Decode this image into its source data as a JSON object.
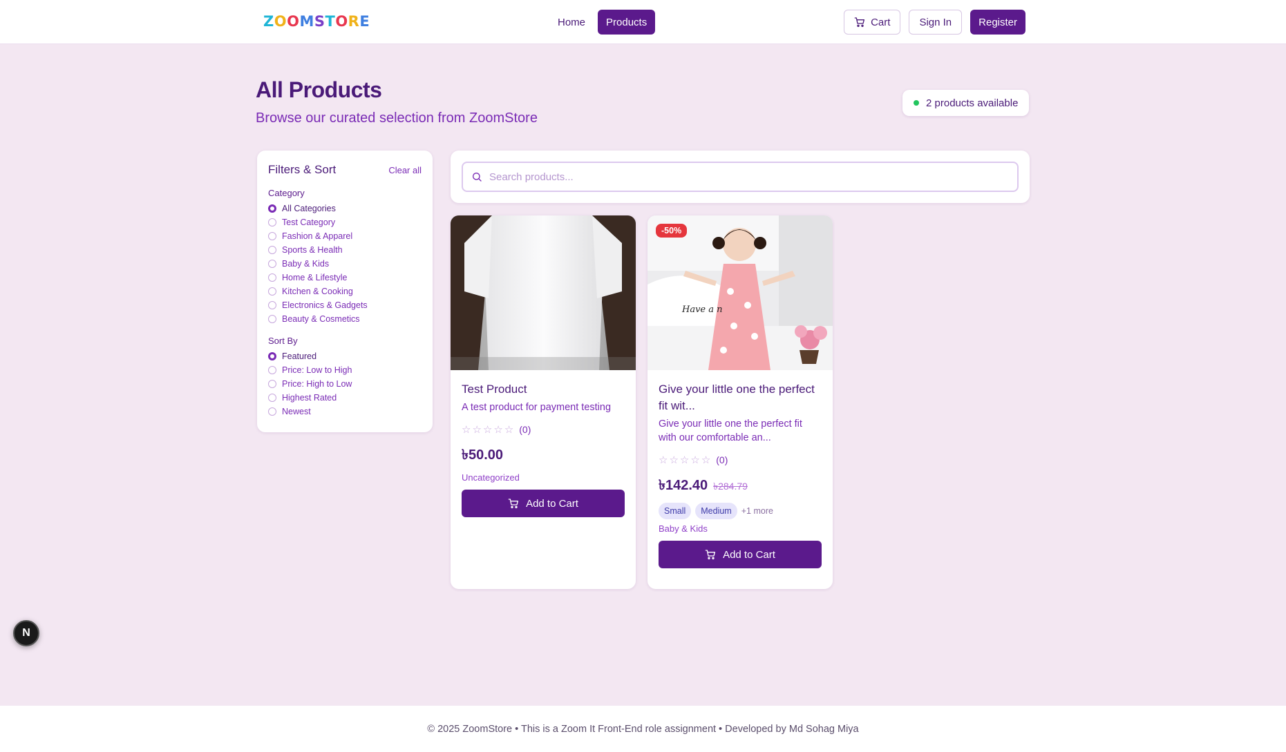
{
  "header": {
    "logo_letters": [
      "Z",
      "O",
      "O",
      "M",
      "S",
      "T",
      "O",
      "R",
      "E"
    ],
    "logo_colors": [
      "#1fb5d6",
      "#f0b21a",
      "#e8374f",
      "#3f7fe0",
      "#7a3fc8",
      "#1fb5d6",
      "#e8374f",
      "#f0b21a",
      "#3f7fe0"
    ],
    "nav": {
      "home": "Home",
      "products": "Products"
    },
    "cart": "Cart",
    "sign_in": "Sign In",
    "register": "Register"
  },
  "page": {
    "title": "All Products",
    "subtitle": "Browse our curated selection from ZoomStore",
    "availability": "2 products available"
  },
  "filters": {
    "title": "Filters & Sort",
    "clear_all": "Clear all",
    "category_label": "Category",
    "categories": [
      "All Categories",
      "Test Category",
      "Fashion & Apparel",
      "Sports & Health",
      "Baby & Kids",
      "Home & Lifestyle",
      "Kitchen & Cooking",
      "Electronics & Gadgets",
      "Beauty & Cosmetics"
    ],
    "selected_category": "All Categories",
    "sort_label": "Sort By",
    "sorts": [
      "Featured",
      "Price: Low to High",
      "Price: High to Low",
      "Highest Rated",
      "Newest"
    ],
    "selected_sort": "Featured"
  },
  "search": {
    "placeholder": "Search products..."
  },
  "products": [
    {
      "title": "Test Product",
      "description": "A test product for payment testing",
      "rating_count": "(0)",
      "price": "৳50.00",
      "category": "Uncategorized",
      "add_label": "Add to Cart"
    },
    {
      "title": "Give your little one the perfect fit wit...",
      "description": "Give your little one the perfect fit with our comfortable an...",
      "rating_count": "(0)",
      "price": "৳142.40",
      "old_price": "৳284.79",
      "discount": "-50%",
      "sizes": [
        "Small",
        "Medium"
      ],
      "more_sizes": "+1 more",
      "category": "Baby & Kids",
      "add_label": "Add to Cart"
    }
  ],
  "dev_badge": "N",
  "footer": "© 2025 ZoomStore • This is a Zoom It Front-End role assignment • Developed by Md Sohag Miya"
}
